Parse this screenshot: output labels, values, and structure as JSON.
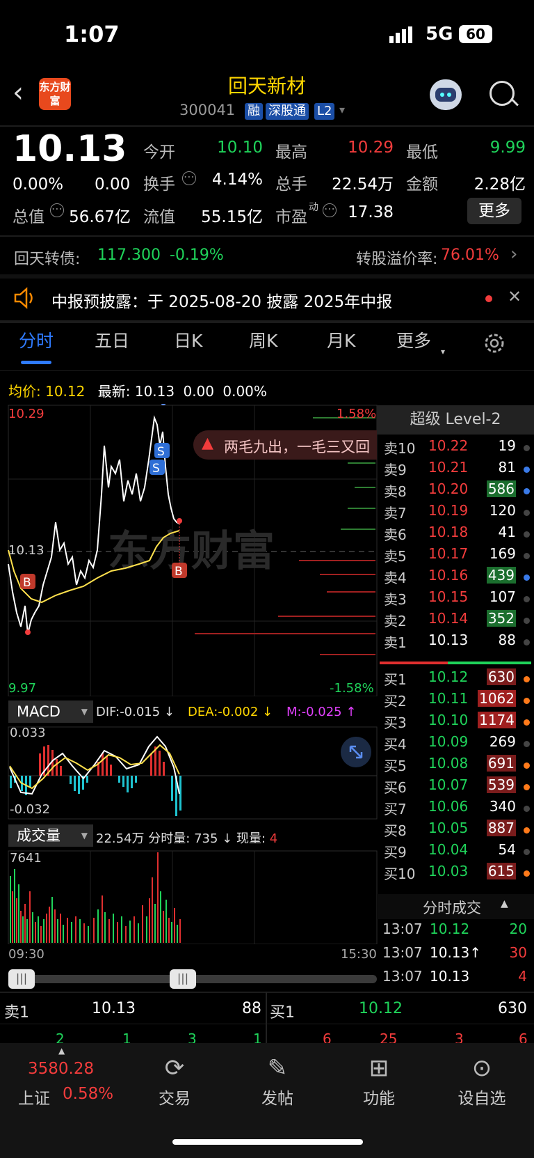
{
  "status_bar": {
    "time": "1:07",
    "network": "5G",
    "battery": "60"
  },
  "header": {
    "title": "回天新材",
    "code": "300041",
    "tags": [
      "融",
      "深股通",
      "L2"
    ],
    "logo_text": "东方财富"
  },
  "quote": {
    "price": "10.13",
    "change_pct": "0.00%",
    "change": "0.00",
    "open_label": "今开",
    "open": "10.10",
    "high_label": "最高",
    "high": "10.29",
    "low_label": "最低",
    "low": "9.99",
    "turnover_label": "换手",
    "turnover": "4.14%",
    "volume_label": "总手",
    "volume": "22.54万",
    "amount_label": "金额",
    "amount": "2.28亿",
    "mktcap_label": "总值",
    "mktcap": "56.67亿",
    "float_label": "流值",
    "float_cap": "55.15亿",
    "pe_label": "市盈",
    "pe_sup": "动",
    "pe": "17.38",
    "more_button": "更多"
  },
  "bond": {
    "name": "回天转债:",
    "price": "117.300",
    "change": "-0.19%",
    "premium_label": "转股溢价率:",
    "premium": "76.01%"
  },
  "notice": {
    "text": "中报预披露：于 2025-08-20 披露 2025年中报"
  },
  "tabs": [
    "分时",
    "五日",
    "日K",
    "周K",
    "月K",
    "更多"
  ],
  "info_line": {
    "avg_label": "均价:",
    "avg": "10.12",
    "latest_label": "最新:",
    "latest": "10.13",
    "chg": "0.00",
    "pct": "0.00%"
  },
  "chart_axis": {
    "top_price": "10.29",
    "mid_price": "10.13",
    "bottom_price": "9.97",
    "top_pct": "1.58%",
    "bottom_pct": "-1.58%",
    "time_start": "09:30",
    "time_end": "15:30",
    "watermark": "东方财富"
  },
  "bubble": "两毛九出，一毛三又回",
  "macd": {
    "label": "MACD",
    "dif": "DIF:-0.015 ↓",
    "dea": "DEA:-0.002 ↓",
    "m": "M:-0.025 ↑",
    "top": "0.033",
    "bottom": "-0.032"
  },
  "vol": {
    "label": "成交量",
    "total": "22.54万",
    "minute_label": "分时量:",
    "minute": "735 ↓",
    "now_label": "现量:",
    "now": "4",
    "top": "7641"
  },
  "level2": {
    "title": "超级 Level-2",
    "asks": [
      {
        "n": "卖10",
        "p": "10.22",
        "q": "19"
      },
      {
        "n": "卖9",
        "p": "10.21",
        "q": "81"
      },
      {
        "n": "卖8",
        "p": "10.20",
        "q": "586"
      },
      {
        "n": "卖7",
        "p": "10.19",
        "q": "120"
      },
      {
        "n": "卖6",
        "p": "10.18",
        "q": "41"
      },
      {
        "n": "卖5",
        "p": "10.17",
        "q": "169"
      },
      {
        "n": "卖4",
        "p": "10.16",
        "q": "439"
      },
      {
        "n": "卖3",
        "p": "10.15",
        "q": "107"
      },
      {
        "n": "卖2",
        "p": "10.14",
        "q": "352"
      },
      {
        "n": "卖1",
        "p": "10.13",
        "q": "88"
      }
    ],
    "bids": [
      {
        "n": "买1",
        "p": "10.12",
        "q": "630"
      },
      {
        "n": "买2",
        "p": "10.11",
        "q": "1062"
      },
      {
        "n": "买3",
        "p": "10.10",
        "q": "1174"
      },
      {
        "n": "买4",
        "p": "10.09",
        "q": "269"
      },
      {
        "n": "买5",
        "p": "10.08",
        "q": "691"
      },
      {
        "n": "买6",
        "p": "10.07",
        "q": "539"
      },
      {
        "n": "买7",
        "p": "10.06",
        "q": "340"
      },
      {
        "n": "买8",
        "p": "10.05",
        "q": "887"
      },
      {
        "n": "买9",
        "p": "10.04",
        "q": "54"
      },
      {
        "n": "买10",
        "p": "10.03",
        "q": "615"
      }
    ],
    "trades_title": "分时成交",
    "trades": [
      {
        "t": "13:07",
        "p": "10.12",
        "q": "20"
      },
      {
        "t": "13:07",
        "p": "10.13↑",
        "q": "30"
      },
      {
        "t": "13:07",
        "p": "10.13",
        "q": "4"
      }
    ]
  },
  "bottom_quote": {
    "sell_label": "卖1",
    "sell_price": "10.13",
    "sell_qty": "88",
    "buy_label": "买1",
    "buy_price": "10.12",
    "buy_qty": "630",
    "row": [
      "2",
      "1",
      "3",
      "1",
      "6",
      "25",
      "3",
      "6"
    ]
  },
  "bottom_nav": {
    "index_value": "3580.28",
    "index_name": "上证",
    "index_pct": "0.58%",
    "items": [
      "交易",
      "发帖",
      "功能",
      "设自选"
    ]
  }
}
